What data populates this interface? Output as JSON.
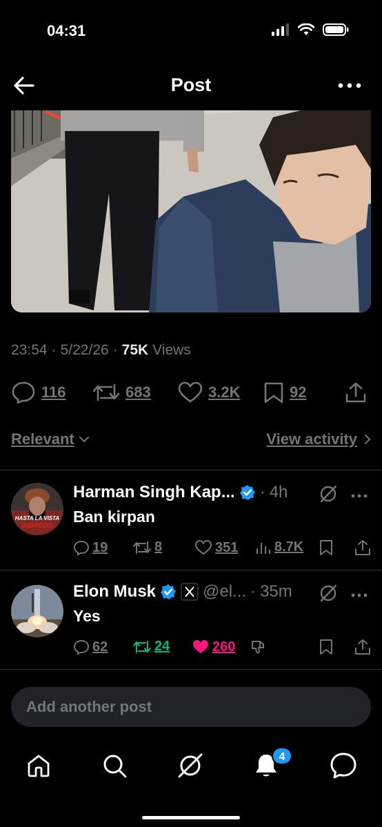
{
  "status_bar": {
    "time": "04:31"
  },
  "header": {
    "title": "Post"
  },
  "post": {
    "time": "23:54",
    "date": "5/22/26",
    "views_count": "75K",
    "views_label": "Views",
    "replies": "116",
    "reposts": "683",
    "likes": "3.2K",
    "bookmarks": "92"
  },
  "filter": {
    "sort_label": "Relevant",
    "activity_label": "View activity"
  },
  "replies": [
    {
      "name": "Harman Singh Kap...",
      "time": "4h",
      "text": "Ban kirpan",
      "avatar_text": "HASTA LA VISTA INBREDS",
      "replies": "19",
      "reposts": "8",
      "likes": "351",
      "views": "8.7K"
    },
    {
      "name": "Elon Musk",
      "handle": "@el...",
      "time": "35m",
      "text": "Yes",
      "replies": "62",
      "reposts": "24",
      "likes": "260"
    }
  ],
  "composer": {
    "placeholder": "Add another post"
  },
  "tabbar": {
    "notifications_badge": "4"
  },
  "colors": {
    "accent": "#1d9bf0",
    "like": "#f91880",
    "repost": "#00ba7c",
    "muted": "#71767b"
  },
  "icons": [
    "back-arrow-icon",
    "more-icon",
    "reply-icon",
    "repost-icon",
    "like-icon",
    "bookmark-icon",
    "share-icon",
    "chevron-down-icon",
    "chevron-right-icon",
    "verified-icon",
    "grok-icon",
    "views-icon",
    "dislike-icon",
    "home-icon",
    "search-icon",
    "grok-tab-icon",
    "bell-icon",
    "messages-icon"
  ]
}
